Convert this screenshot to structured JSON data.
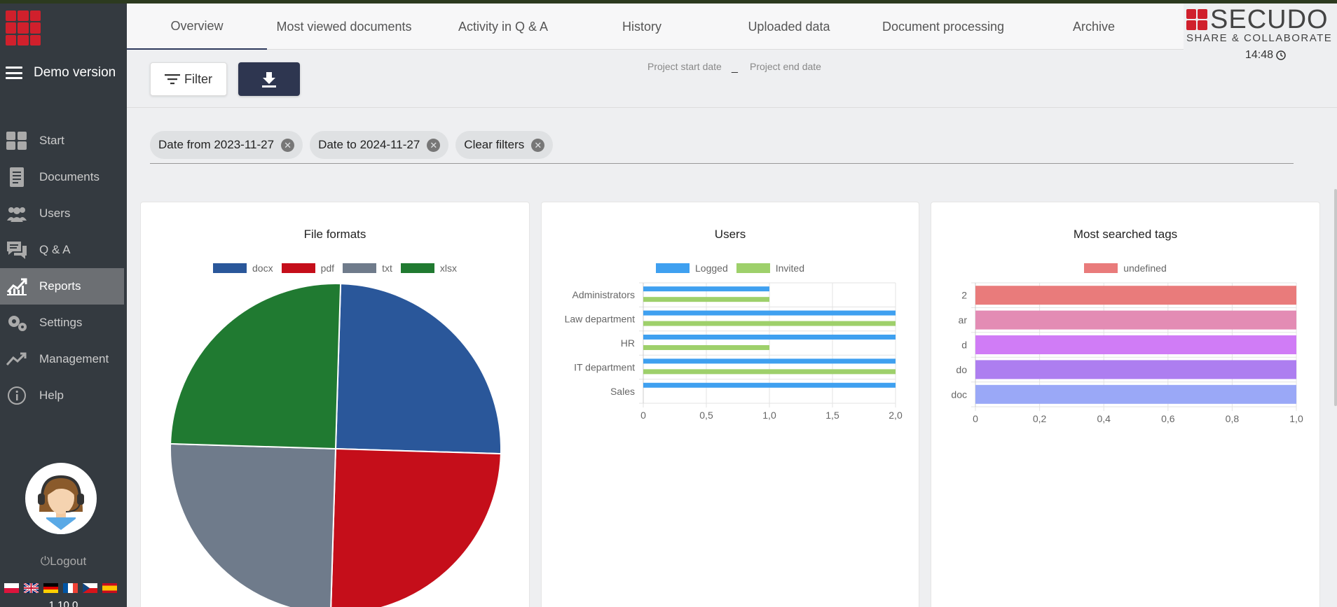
{
  "sidebar": {
    "menu_label": "Demo version",
    "items": [
      {
        "label": "Start",
        "icon": "grid-icon",
        "active": false
      },
      {
        "label": "Documents",
        "icon": "document-icon",
        "active": false
      },
      {
        "label": "Users",
        "icon": "users-icon",
        "active": false
      },
      {
        "label": "Q & A",
        "icon": "chat-icon",
        "active": false
      },
      {
        "label": "Reports",
        "icon": "chart-icon",
        "active": true
      },
      {
        "label": "Settings",
        "icon": "gear-icon",
        "active": false
      },
      {
        "label": "Management",
        "icon": "trend-icon",
        "active": false
      },
      {
        "label": "Help",
        "icon": "info-icon",
        "active": false
      }
    ],
    "logout_label": "Logout",
    "flags": [
      "pl",
      "gb",
      "de",
      "fr",
      "cz",
      "es"
    ],
    "version": "1.10.0"
  },
  "tabs": [
    {
      "label": "Overview",
      "active": true
    },
    {
      "label": "Most viewed documents",
      "active": false
    },
    {
      "label": "Activity in Q & A",
      "active": false
    },
    {
      "label": "History",
      "active": false
    },
    {
      "label": "Uploaded data",
      "active": false
    },
    {
      "label": "Document processing",
      "active": false
    },
    {
      "label": "Archive",
      "active": false
    }
  ],
  "brand": {
    "name": "SECUDO",
    "tagline": "SHARE & COLLABORATE",
    "time": "14:48",
    "accent_color": "#d0202c"
  },
  "toolbar": {
    "filter_label": "Filter",
    "project_start_label": "Project start date",
    "project_dash": "_",
    "project_end_label": "Project end date"
  },
  "filters": {
    "chips": [
      {
        "label": "Date from 2023-11-27"
      },
      {
        "label": "Date to 2024-11-27"
      },
      {
        "label": "Clear filters"
      }
    ],
    "remove_glyph": "✕"
  },
  "chart_data": [
    {
      "type": "pie",
      "title": "File formats",
      "legend_placement": "top",
      "labels": [
        "docx",
        "pdf",
        "txt",
        "xlsx"
      ],
      "values": [
        1,
        1,
        1,
        1
      ],
      "colors": [
        "#2a579a",
        "#c50e1a",
        "#6f7b8b",
        "#207a31"
      ]
    },
    {
      "type": "bar",
      "orientation": "horizontal",
      "title": "Users",
      "legend_placement": "top",
      "categories": [
        "Administrators",
        "Law department",
        "HR",
        "IT department",
        "Sales"
      ],
      "series": [
        {
          "name": "Logged",
          "values": [
            1,
            2,
            2,
            2,
            2
          ],
          "color": "#3fa0f0"
        },
        {
          "name": "Invited",
          "values": [
            1,
            2,
            1,
            2,
            0
          ],
          "color": "#9ed06b"
        }
      ],
      "xlim": [
        0,
        2
      ],
      "xticks": [
        "0",
        "0,5",
        "1,0",
        "1,5",
        "2,0"
      ],
      "grid": true
    },
    {
      "type": "bar",
      "orientation": "horizontal",
      "title": "Most searched tags",
      "legend_placement": "top",
      "categories": [
        "2",
        "ar",
        "d",
        "do",
        "doc"
      ],
      "series": [
        {
          "name": "undefined",
          "values": [
            1,
            1,
            1,
            1,
            1
          ]
        }
      ],
      "legend_color": "#e97b7b",
      "bar_colors": [
        "#e97b7b",
        "#e38cb4",
        "#d07cf6",
        "#ad7ef0",
        "#9aa8f7"
      ],
      "xlim": [
        0,
        1
      ],
      "xticks": [
        "0",
        "0,2",
        "0,4",
        "0,6",
        "0,8",
        "1,0"
      ],
      "grid": true
    }
  ]
}
